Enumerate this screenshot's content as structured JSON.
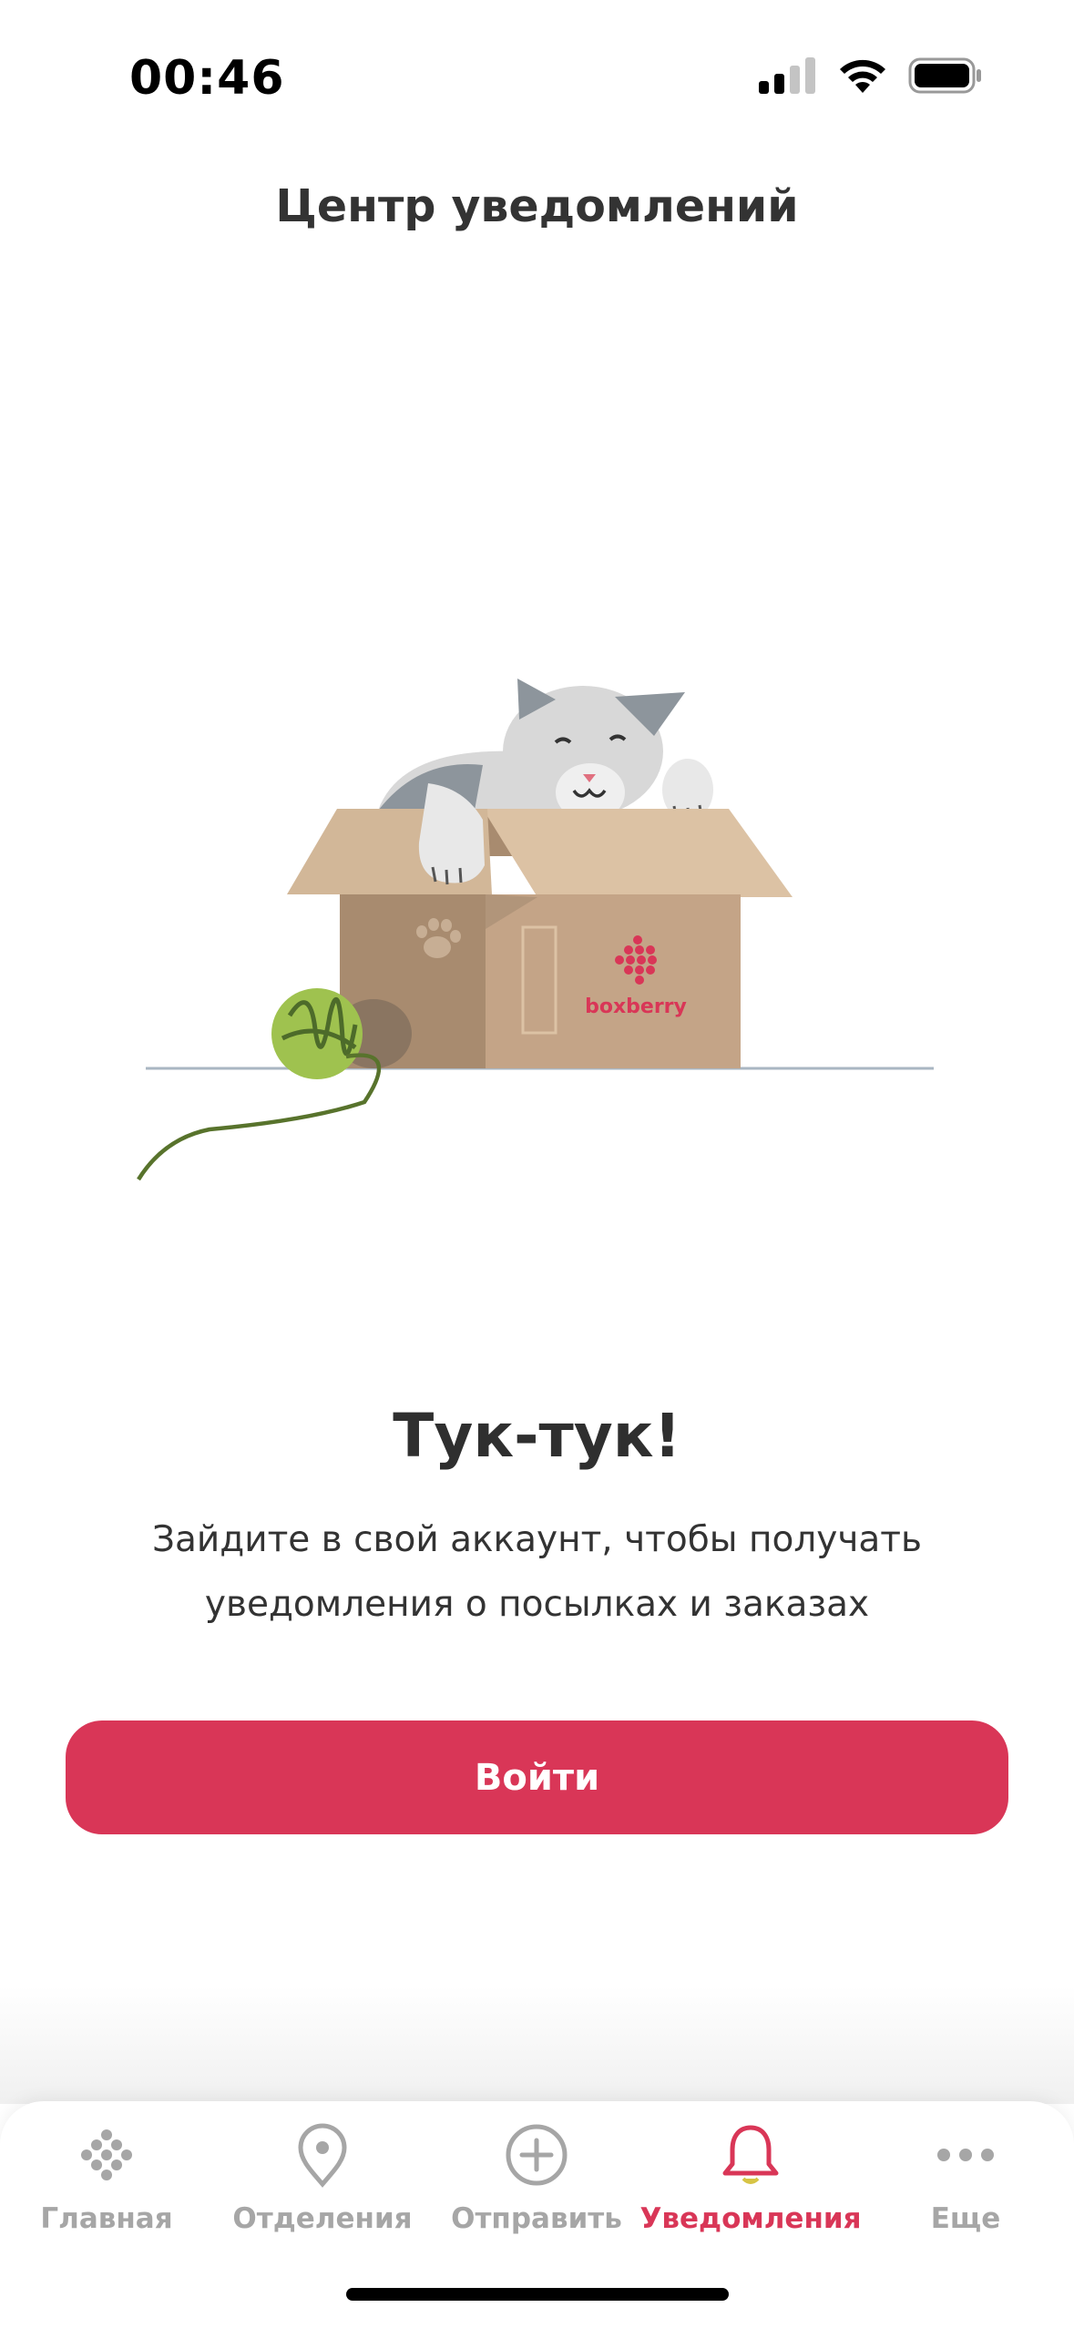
{
  "status_bar": {
    "time": "00:46"
  },
  "header": {
    "title": "Центр уведомлений"
  },
  "illustration": {
    "brand_label": "boxberry"
  },
  "message": {
    "title": "Тук-тук!",
    "text": "Зайдите в свой аккаунт, чтобы получать уведомления о посылках и заказах"
  },
  "login_button": {
    "label": "Войти"
  },
  "tab_bar": {
    "items": [
      {
        "label": "Главная",
        "icon": "boxberry-dots-icon",
        "active": false
      },
      {
        "label": "Отделения",
        "icon": "map-pin-icon",
        "active": false
      },
      {
        "label": "Отправить",
        "icon": "plus-circle-icon",
        "active": false
      },
      {
        "label": "Уведомления",
        "icon": "bell-icon",
        "active": true
      },
      {
        "label": "Еще",
        "icon": "more-dots-icon",
        "active": false
      }
    ]
  },
  "colors": {
    "accent": "#d93657",
    "inactive": "#a6a6a6",
    "text": "#2f2f2f"
  }
}
